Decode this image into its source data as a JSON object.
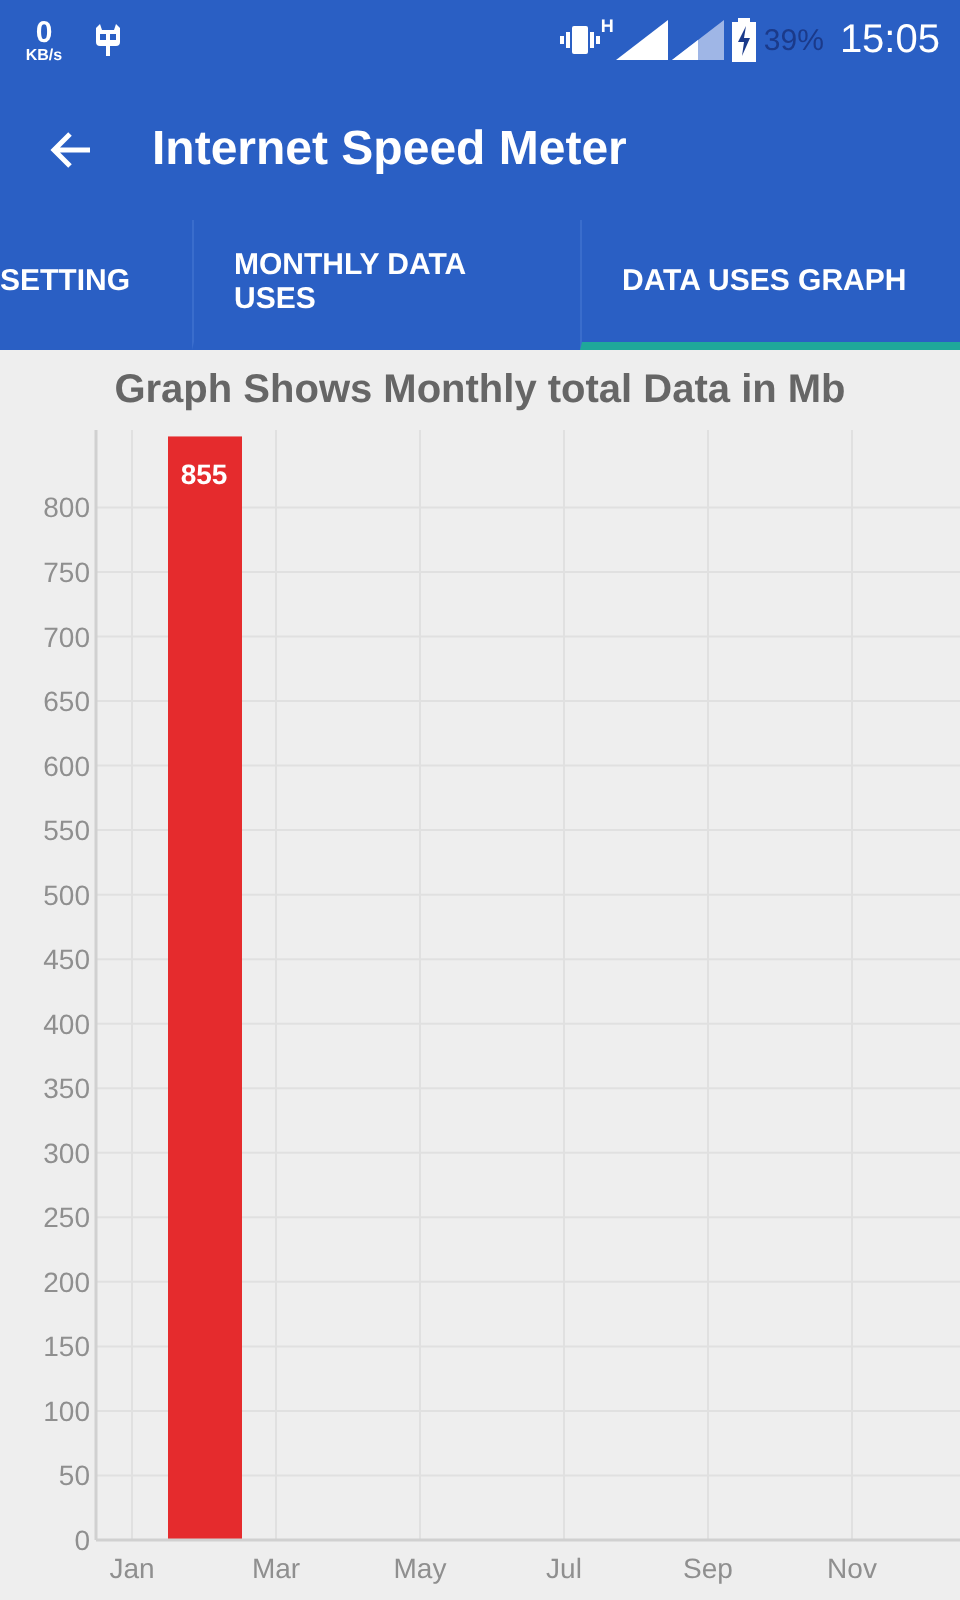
{
  "status_bar": {
    "speed_value": "0",
    "speed_unit": "KB/s",
    "network_type": "H",
    "battery": "39%",
    "time": "15:05"
  },
  "app_bar": {
    "title": "Internet Speed Meter"
  },
  "tabs": [
    {
      "label": "SETTING",
      "selected": false
    },
    {
      "label": "MONTHLY DATA USES",
      "selected": false
    },
    {
      "label": "DATA USES GRAPH",
      "selected": true
    }
  ],
  "chart": {
    "title": "Graph Shows Monthly total Data in Mb",
    "chart_data": {
      "type": "bar",
      "categories": [
        "Jan",
        null,
        "Mar",
        null,
        "May",
        null,
        "Jul",
        null,
        "Sep",
        null,
        "Nov",
        null
      ],
      "series": [
        {
          "color": "#e52b2d",
          "values": [
            0,
            855,
            0,
            0,
            0,
            0,
            0,
            0,
            0,
            0,
            0,
            0
          ]
        }
      ],
      "ylim": [
        0,
        860
      ],
      "yticks": [
        0,
        50,
        100,
        150,
        200,
        250,
        300,
        350,
        400,
        450,
        500,
        550,
        600,
        650,
        700,
        750,
        800
      ],
      "grid": true,
      "value_labels": [
        null,
        "855",
        null,
        null,
        null,
        null,
        null,
        null,
        null,
        null,
        null,
        null
      ]
    }
  }
}
